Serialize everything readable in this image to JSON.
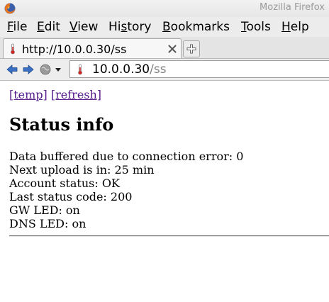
{
  "window": {
    "title": "Mozilla Firefox",
    "logo_icon": "firefox-logo-icon"
  },
  "menubar": {
    "items": [
      {
        "accel": "F",
        "rest": "ile"
      },
      {
        "accel": "E",
        "rest": "dit"
      },
      {
        "accel": "V",
        "rest": "iew"
      },
      {
        "pre": "Hi",
        "accel": "s",
        "rest": "tory"
      },
      {
        "accel": "B",
        "rest": "ookmarks"
      },
      {
        "accel": "T",
        "rest": "ools"
      },
      {
        "accel": "H",
        "rest": "elp"
      }
    ]
  },
  "tabs": {
    "active_tab": {
      "label": "http://10.0.0.30/ss",
      "favicon": "thermometer-icon",
      "close_icon": "close-icon"
    },
    "new_tab_icon": "plus-icon"
  },
  "navbar": {
    "url_host": "10.0.0.30",
    "url_path": "/ss",
    "favicon": "thermometer-icon"
  },
  "page": {
    "links": [
      "[temp]",
      "[refresh]"
    ],
    "heading": "Status info",
    "status_lines": [
      "Data buffered due to connection error: 0",
      "Next upload is in: 25 min",
      "Account status: OK",
      "Last status code: 200",
      "GW LED: on",
      "DNS LED: on"
    ]
  },
  "colors": {
    "link_visited": "#551a8b",
    "url_path": "#808080",
    "title_text": "#9a9a9a"
  }
}
